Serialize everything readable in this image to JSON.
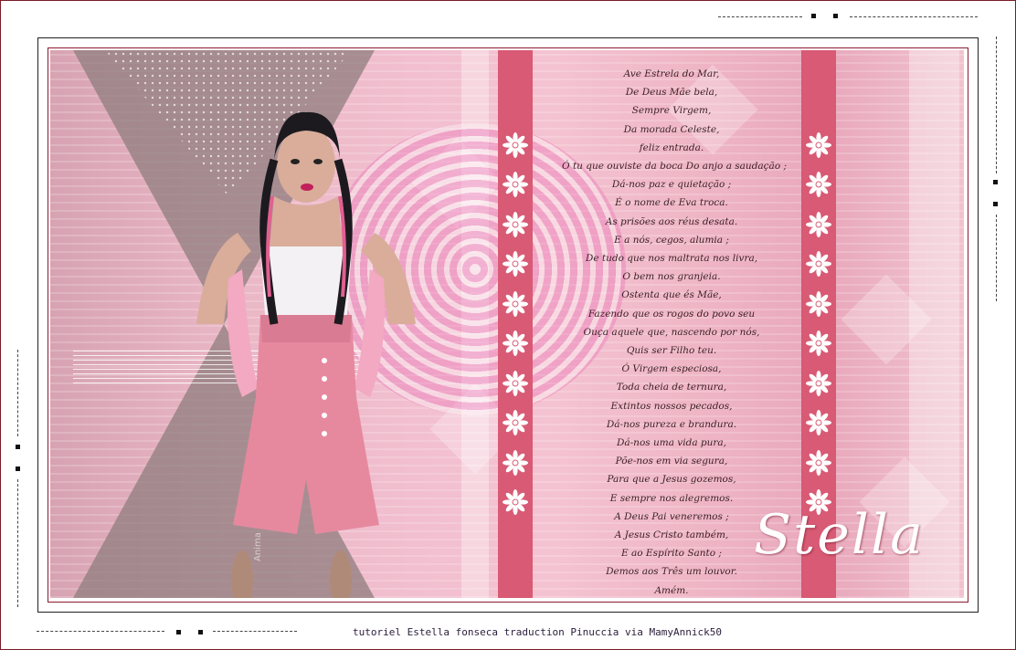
{
  "credit": "tutoriel Estella fonseca traduction Pinuccia via MamyAnnick50",
  "signature": "Anima",
  "title": "Stella",
  "poem": [
    "Ave Estrela do Mar,",
    "De Deus Mãe bela,",
    "Sempre Virgem,",
    "Da morada Celeste,",
    "feliz entrada.",
    "Ó tu que ouviste da boca Do anjo a saudação ;",
    "Dá-nos paz e quietação ;",
    "É o nome de Eva troca.",
    "As prisões aos réus desata.",
    "E a nós, cegos, alumia ;",
    "De tudo que nos maltrata nos livra,",
    "O bem nos granjeia.",
    "Ostenta que és Mãe,",
    "Fazendo que os rogos do povo seu",
    "Ouça aquele que, nascendo por nós,",
    "Quis ser Filho teu.",
    "Ó Virgem especiosa,",
    "Toda cheia de ternura,",
    "Extintos nossos pecados,",
    "Dá-nos pureza e brandura.",
    "Dá-nos uma vida pura,",
    "Põe-nos em via segura,",
    "Para que a Jesus gozemos,",
    "E sempre nos alegremos.",
    "A Deus Pai veneremos ;",
    "A Jesus Cristo também,",
    "E ao Espírito Santo ;",
    "Demos aos Três um louvor.",
    "Amém."
  ],
  "icons": {
    "flower": "flower-icon"
  },
  "colors": {
    "band": "#d85a74",
    "frame": "#8a1a2e"
  }
}
